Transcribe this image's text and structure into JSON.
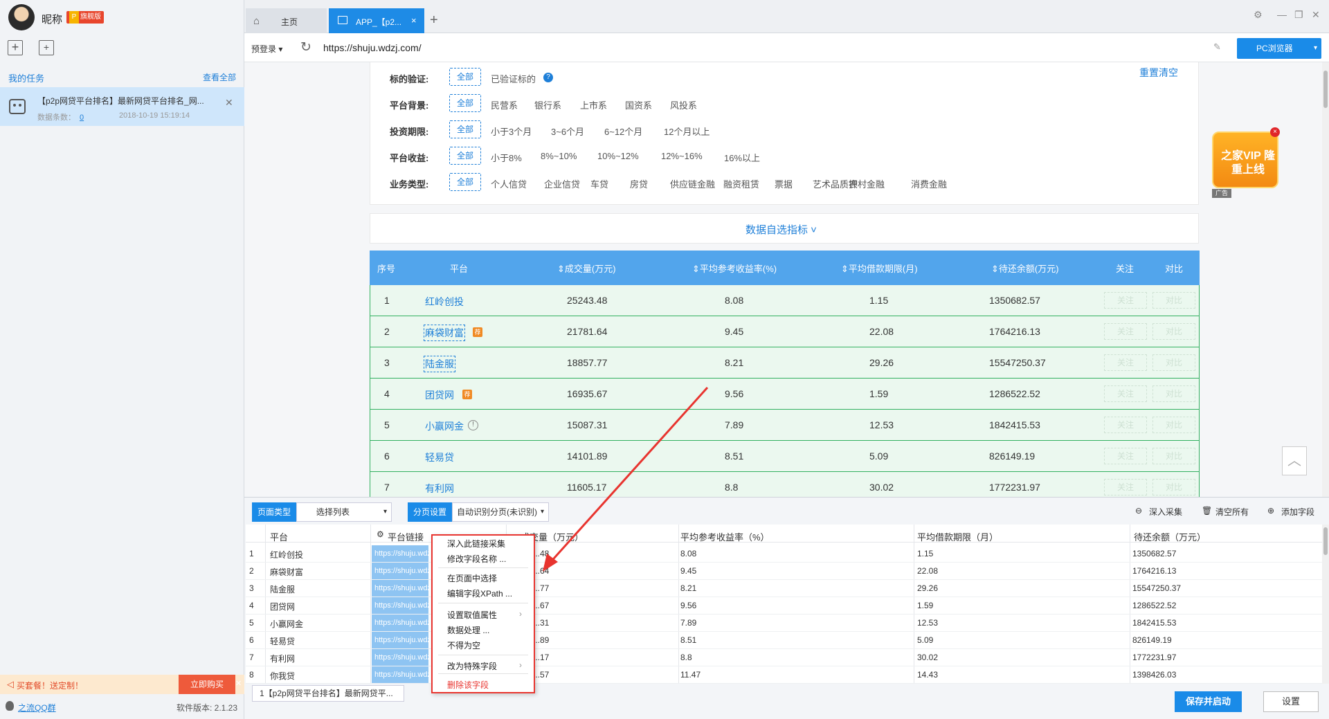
{
  "sidebar": {
    "nickname": "昵称",
    "vip_p": "P",
    "vip_label": "旗舰版",
    "my_tasks": "我的任务",
    "view_all": "查看全部",
    "task": {
      "title": "【p2p网贷平台排名】最新网贷平台排名_网...",
      "count_label": "数据条数：",
      "count": "0",
      "time": "2018-10-19 15:19:14"
    },
    "promo": {
      "text": "买套餐！送定制！",
      "button": "立即购买",
      "close": "✕"
    },
    "qq_group": "之流QQ群",
    "version": "软件版本: 2.1.23"
  },
  "tabs": {
    "home": "主页",
    "app": "APP_【p2...",
    "close": "×",
    "add": "+"
  },
  "address": {
    "prelogin": "预登录 ▾",
    "url": "https://shuju.wdzj.com/",
    "pc_browser": "PC浏览器",
    "pc_arrow": "▾"
  },
  "filters": {
    "reset": "重置清空",
    "all": "全部",
    "rows": [
      {
        "label": "标的验证:",
        "options": [
          "已验证标的"
        ]
      },
      {
        "label": "平台背景:",
        "options": [
          "民营系",
          "银行系",
          "上市系",
          "国资系",
          "风投系"
        ]
      },
      {
        "label": "投资期限:",
        "options": [
          "小于3个月",
          "3~6个月",
          "6~12个月",
          "12个月以上"
        ]
      },
      {
        "label": "平台收益:",
        "options": [
          "小于8%",
          "8%~10%",
          "10%~12%",
          "12%~16%",
          "16%以上"
        ]
      },
      {
        "label": "业务类型:",
        "options": [
          "个人信贷",
          "企业信贷",
          "车贷",
          "房贷",
          "供应链金融",
          "融资租赁",
          "票据",
          "艺术品质押",
          "农村金融",
          "消费金融"
        ]
      }
    ],
    "self_pick": "数据自选指标 ˅"
  },
  "ranking": {
    "headers": [
      "序号",
      "平台",
      "⇕成交量(万元)",
      "⇕平均参考收益率(%)",
      "⇕平均借款期限(月)",
      "⇕待还余额(万元)",
      "关注",
      "对比"
    ],
    "follow": "关注",
    "compare": "对比",
    "rows": [
      {
        "n": "1",
        "name": "红岭创投",
        "vol": "25243.48",
        "rate": "8.08",
        "term": "1.15",
        "bal": "1350682.57"
      },
      {
        "n": "2",
        "name": "麻袋财富",
        "vol": "21781.64",
        "rate": "9.45",
        "term": "22.08",
        "bal": "1764216.13"
      },
      {
        "n": "3",
        "name": "陆金服",
        "vol": "18857.77",
        "rate": "8.21",
        "term": "29.26",
        "bal": "15547250.37"
      },
      {
        "n": "4",
        "name": "团贷网",
        "vol": "16935.67",
        "rate": "9.56",
        "term": "1.59",
        "bal": "1286522.52"
      },
      {
        "n": "5",
        "name": "小赢网金",
        "vol": "15087.31",
        "rate": "7.89",
        "term": "12.53",
        "bal": "1842415.53"
      },
      {
        "n": "6",
        "name": "轻易贷",
        "vol": "14101.89",
        "rate": "8.51",
        "term": "5.09",
        "bal": "826149.19"
      },
      {
        "n": "7",
        "name": "有利网",
        "vol": "11605.17",
        "rate": "8.8",
        "term": "30.02",
        "bal": "1772231.97"
      }
    ]
  },
  "ad": {
    "text": "之家VIP 隆重上线",
    "tag": "广告"
  },
  "panel": {
    "page_type_label": "页面类型",
    "page_type_value": "选择列表",
    "paging_label": "分页设置",
    "paging_value": "自动识别分页(未识别)",
    "deep_collect": "深入采集",
    "clear_all": "清空所有",
    "add_field": "添加字段",
    "columns": [
      "平台",
      "平台链接",
      "成交量（万元）",
      "平均参考收益率（%）",
      "平均借款期限（月）",
      "待还余额（万元）"
    ],
    "rows": [
      {
        "n": "1",
        "name": "红岭创投",
        "link": "https://shuju.wdzj.com",
        "vol": "...48",
        "rate": "8.08",
        "term": "1.15",
        "bal": "1350682.57"
      },
      {
        "n": "2",
        "name": "麻袋财富",
        "link": "https://shuju.wdzj.com",
        "vol": "...64",
        "rate": "9.45",
        "term": "22.08",
        "bal": "1764216.13"
      },
      {
        "n": "3",
        "name": "陆金服",
        "link": "https://shuju.wdzj.com",
        "vol": "...77",
        "rate": "8.21",
        "term": "29.26",
        "bal": "15547250.37"
      },
      {
        "n": "4",
        "name": "团贷网",
        "link": "https://shuju.wdzj.com",
        "vol": "...67",
        "rate": "9.56",
        "term": "1.59",
        "bal": "1286522.52"
      },
      {
        "n": "5",
        "name": "小赢网金",
        "link": "https://shuju.wdzj.com",
        "vol": "...31",
        "rate": "7.89",
        "term": "12.53",
        "bal": "1842415.53"
      },
      {
        "n": "6",
        "name": "轻易贷",
        "link": "https://shuju.wdzj.com",
        "vol": "...89",
        "rate": "8.51",
        "term": "5.09",
        "bal": "826149.19"
      },
      {
        "n": "7",
        "name": "有利网",
        "link": "https://shuju.wdzj.com",
        "vol": "...17",
        "rate": "8.8",
        "term": "30.02",
        "bal": "1772231.97"
      },
      {
        "n": "8",
        "name": "你我贷",
        "link": "https://shuju.wdzj.com",
        "vol": "...57",
        "rate": "11.47",
        "term": "14.43",
        "bal": "1398426.03"
      }
    ],
    "task_chip": "1【p2p网贷平台排名】最新网贷平...",
    "save": "保存并启动",
    "settings": "设置"
  },
  "context_menu": {
    "items": [
      "深入此链接采集",
      "修改字段名称 ...",
      "在页面中选择",
      "编辑字段XPath ...",
      "设置取值属性",
      "数据处理 ...",
      "不得为空",
      "改为特殊字段",
      "删除该字段"
    ]
  },
  "colors": {
    "accent": "#1a8be8",
    "highlight_border": "#31b05f",
    "menu_border": "#e8342f"
  }
}
